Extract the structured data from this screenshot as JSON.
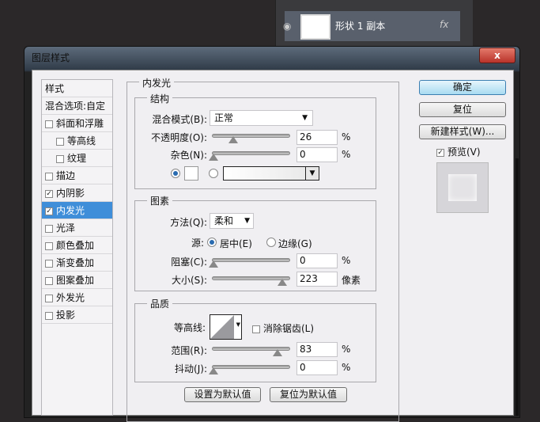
{
  "layers_panel": {
    "layer_name": "形状 1 副本",
    "fx": "fx"
  },
  "dialog": {
    "title": "图层样式",
    "close": "x"
  },
  "sidebar": {
    "header": "样式",
    "blend_options": "混合选项:自定",
    "items": [
      {
        "label": "斜面和浮雕",
        "checked": false
      },
      {
        "label": "等高线",
        "checked": false
      },
      {
        "label": "纹理",
        "checked": false
      },
      {
        "label": "描边",
        "checked": false
      },
      {
        "label": "内阴影",
        "checked": true
      },
      {
        "label": "内发光",
        "checked": true
      },
      {
        "label": "光泽",
        "checked": false
      },
      {
        "label": "颜色叠加",
        "checked": false
      },
      {
        "label": "渐变叠加",
        "checked": false
      },
      {
        "label": "图案叠加",
        "checked": false
      },
      {
        "label": "外发光",
        "checked": false
      },
      {
        "label": "投影",
        "checked": false
      }
    ]
  },
  "main": {
    "title": "内发光",
    "structure": {
      "title": "结构",
      "blend_mode_label": "混合模式(B):",
      "blend_mode": "正常",
      "opacity_label": "不透明度(O):",
      "opacity": "26",
      "noise_label": "杂色(N):",
      "noise": "0",
      "pct": "%"
    },
    "elements": {
      "title": "图素",
      "method_label": "方法(Q):",
      "method": "柔和",
      "source_label": "源:",
      "source_center": "居中(E)",
      "source_edge": "边缘(G)",
      "choke_label": "阻塞(C):",
      "choke": "0",
      "size_label": "大小(S):",
      "size": "223",
      "px": "像素"
    },
    "quality": {
      "title": "品质",
      "contour_label": "等高线:",
      "antialias": "消除锯齿(L)",
      "range_label": "范围(R):",
      "range": "83",
      "jitter_label": "抖动(J):",
      "jitter": "0"
    },
    "make_default": "设置为默认值",
    "reset_default": "复位为默认值"
  },
  "buttons": {
    "ok": "确定",
    "reset": "复位",
    "new_style": "新建样式(W)...",
    "preview": "预览(V)"
  }
}
